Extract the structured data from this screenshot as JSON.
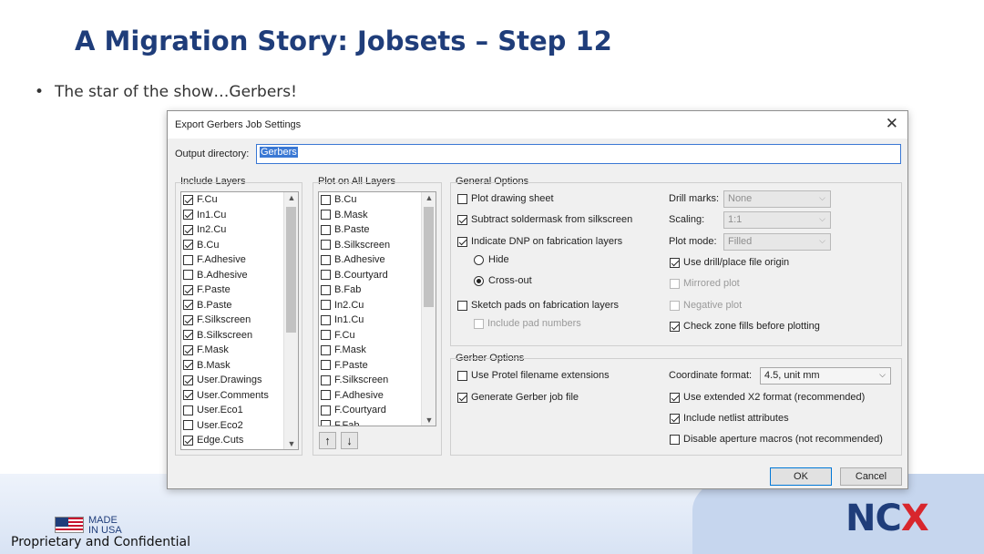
{
  "slide": {
    "title": "A Migration Story: Jobsets – Step 12",
    "bullet": "The star of the show…Gerbers!",
    "footer": {
      "made_in_line1": "MADE",
      "made_in_line2": "IN USA",
      "confidential": "Proprietary and Confidential",
      "logo_nc": "NC",
      "logo_x": "X"
    }
  },
  "dialog": {
    "title": "Export Gerbers Job Settings",
    "output_dir_label": "Output directory:",
    "output_dir_value": "Gerbers",
    "include_layers": {
      "label": "Include Layers",
      "items": [
        {
          "name": "F.Cu",
          "checked": true
        },
        {
          "name": "In1.Cu",
          "checked": true
        },
        {
          "name": "In2.Cu",
          "checked": true
        },
        {
          "name": "B.Cu",
          "checked": true
        },
        {
          "name": "F.Adhesive",
          "checked": false
        },
        {
          "name": "B.Adhesive",
          "checked": false
        },
        {
          "name": "F.Paste",
          "checked": true
        },
        {
          "name": "B.Paste",
          "checked": true
        },
        {
          "name": "F.Silkscreen",
          "checked": true
        },
        {
          "name": "B.Silkscreen",
          "checked": true
        },
        {
          "name": "F.Mask",
          "checked": true
        },
        {
          "name": "B.Mask",
          "checked": true
        },
        {
          "name": "User.Drawings",
          "checked": true
        },
        {
          "name": "User.Comments",
          "checked": true
        },
        {
          "name": "User.Eco1",
          "checked": false
        },
        {
          "name": "User.Eco2",
          "checked": false
        },
        {
          "name": "Edge.Cuts",
          "checked": true
        }
      ]
    },
    "plot_all_layers": {
      "label": "Plot on All Layers",
      "items": [
        {
          "name": "B.Cu",
          "checked": false
        },
        {
          "name": "B.Mask",
          "checked": false
        },
        {
          "name": "B.Paste",
          "checked": false
        },
        {
          "name": "B.Silkscreen",
          "checked": false
        },
        {
          "name": "B.Adhesive",
          "checked": false
        },
        {
          "name": "B.Courtyard",
          "checked": false
        },
        {
          "name": "B.Fab",
          "checked": false
        },
        {
          "name": "In2.Cu",
          "checked": false
        },
        {
          "name": "In1.Cu",
          "checked": false
        },
        {
          "name": "F.Cu",
          "checked": false
        },
        {
          "name": "F.Mask",
          "checked": false
        },
        {
          "name": "F.Paste",
          "checked": false
        },
        {
          "name": "F.Silkscreen",
          "checked": false
        },
        {
          "name": "F.Adhesive",
          "checked": false
        },
        {
          "name": "F.Courtyard",
          "checked": false
        },
        {
          "name": "F.Fab",
          "checked": false
        }
      ],
      "up_icon": "↑",
      "down_icon": "↓"
    },
    "general": {
      "label": "General Options",
      "plot_drawing_sheet": "Plot drawing sheet",
      "subtract_soldermask": "Subtract soldermask from silkscreen",
      "indicate_dnp": "Indicate DNP on fabrication layers",
      "hide": "Hide",
      "cross_out": "Cross-out",
      "sketch_pads": "Sketch pads on fabrication layers",
      "include_pad_numbers": "Include pad numbers",
      "drill_marks_label": "Drill marks:",
      "drill_marks_value": "None",
      "scaling_label": "Scaling:",
      "scaling_value": "1:1",
      "plot_mode_label": "Plot mode:",
      "plot_mode_value": "Filled",
      "use_drill_origin": "Use drill/place file origin",
      "mirrored_plot": "Mirrored plot",
      "negative_plot": "Negative plot",
      "check_zone_fills": "Check zone fills before plotting"
    },
    "gerber": {
      "label": "Gerber Options",
      "protel_ext": "Use Protel filename extensions",
      "gen_job_file": "Generate Gerber job file",
      "coord_format_label": "Coordinate format:",
      "coord_format_value": "4.5, unit mm",
      "x2_format": "Use extended X2 format (recommended)",
      "netlist_attrs": "Include netlist attributes",
      "disable_macros": "Disable aperture macros (not recommended)"
    },
    "ok": "OK",
    "cancel": "Cancel",
    "close_icon": "✕"
  }
}
